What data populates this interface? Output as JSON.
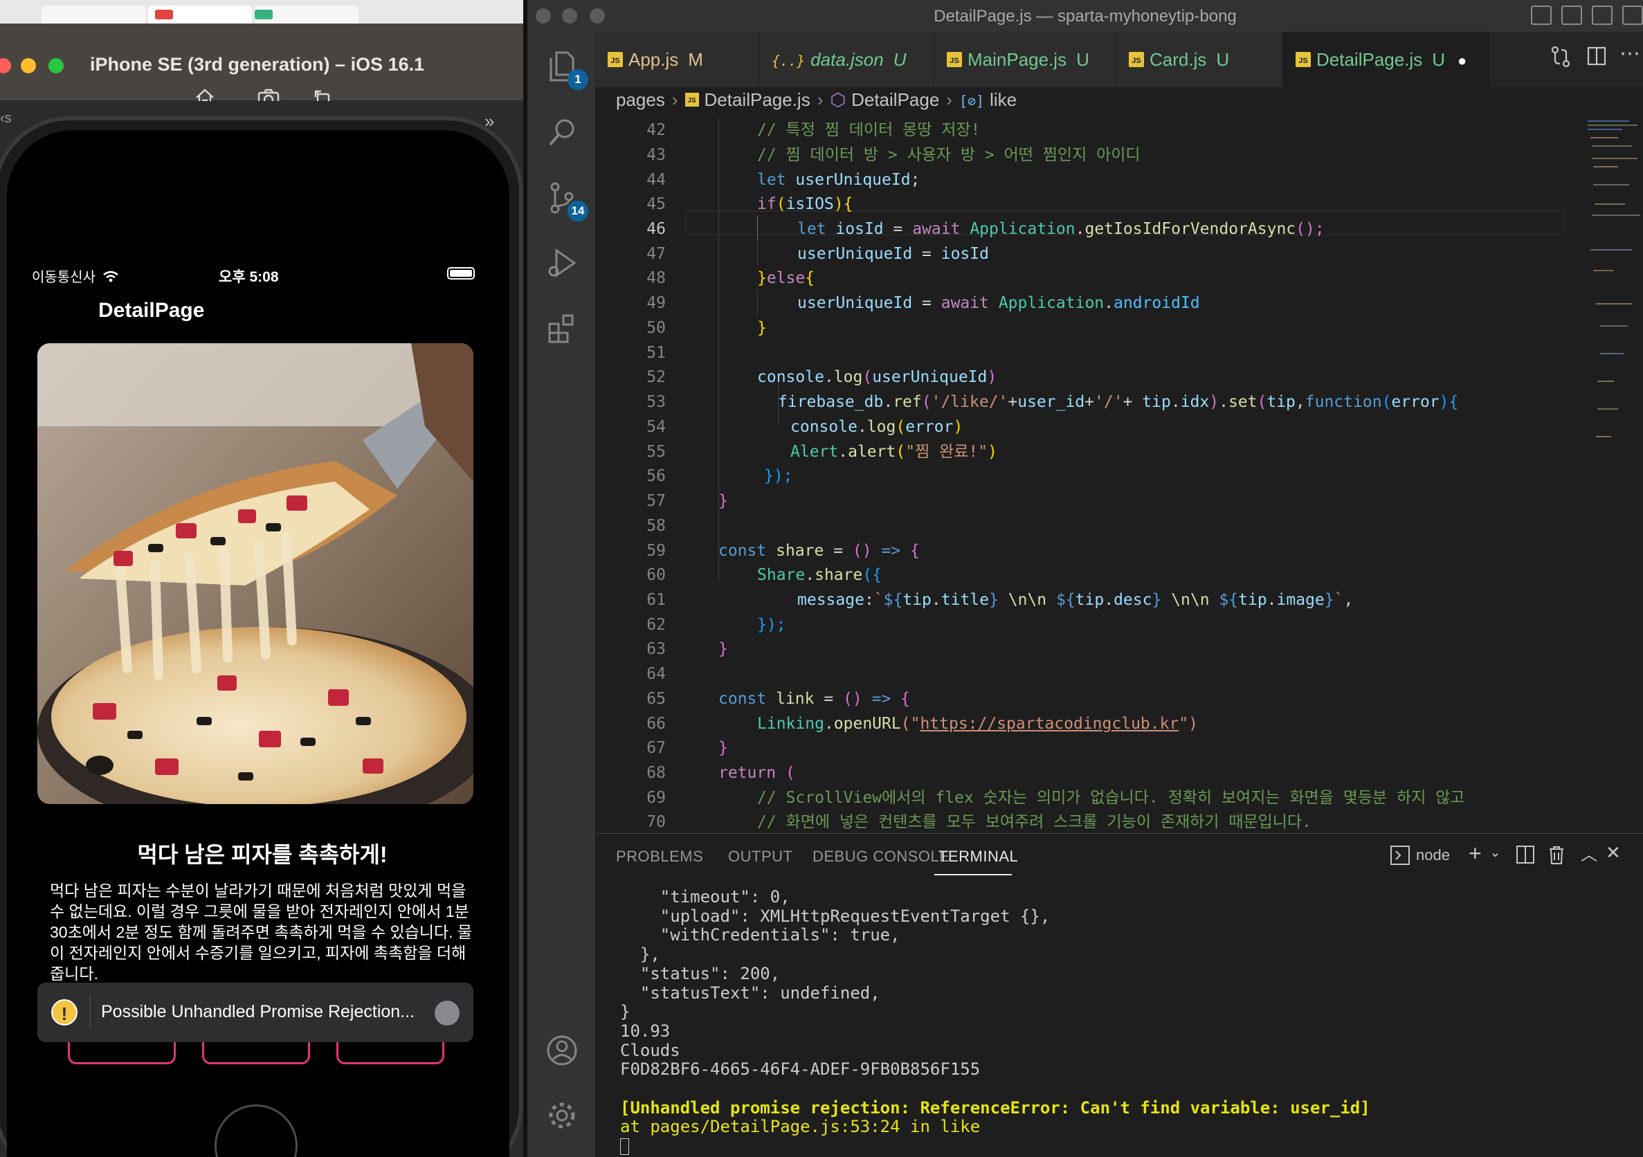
{
  "simulator": {
    "title": "iPhone SE (3rd generation) – iOS 16.1",
    "sidebar_glyph": "‹s",
    "overflow_glyph": "»",
    "tools": [
      "home-icon",
      "screenshot-icon",
      "rotate-icon"
    ],
    "status": {
      "carrier": "이동통신사",
      "time": "오후 5:08"
    },
    "nav_title": "DetailPage",
    "tip": {
      "title": "먹다 남은 피자를 촉촉하게!",
      "desc": "먹다 남은 피자는 수분이 날라가기 때문에 처음처럼 맛있게 먹을 수 없는데요. 이럴 경우 그릇에 물을 받아 전자레인지 안에서 1분 30초에서 2분 정도 함께 돌려주면 촉촉하게 먹을 수 있습니다. 물이 전자레인지 안에서 수증기를 일으키고, 피자에 촉촉함을 더해줍니다."
    },
    "toast": {
      "icon": "!",
      "text": "Possible Unhandled Promise Rejection..."
    },
    "colors": {
      "button_border": "#e3337f",
      "toast_icon": "#f4c542"
    }
  },
  "vscode": {
    "window_title": "DetailPage.js — sparta-myhoneytip-bong",
    "activity_badges": {
      "explorer": "1",
      "source_control": "14"
    },
    "tabs": [
      {
        "label": "App.js",
        "status": "M",
        "kind": "js"
      },
      {
        "label": "data.json",
        "status": "U",
        "kind": "json",
        "json_glyph": "{..}"
      },
      {
        "label": "MainPage.js",
        "status": "U",
        "kind": "js"
      },
      {
        "label": "Card.js",
        "status": "U",
        "kind": "js"
      },
      {
        "label": "DetailPage.js",
        "status": "U",
        "kind": "js",
        "active": true,
        "dirty_glyph": "●"
      }
    ],
    "breadcrumb": [
      "pages",
      "DetailPage.js",
      "DetailPage",
      "like"
    ],
    "line_numbers": [
      "42",
      "43",
      "44",
      "45",
      "46",
      "47",
      "48",
      "49",
      "50",
      "51",
      "52",
      "53",
      "54",
      "55",
      "56",
      "57",
      "58",
      "59",
      "60",
      "61",
      "62",
      "63",
      "64",
      "65",
      "66",
      "67",
      "68",
      "69",
      "70"
    ],
    "code": {
      "l42": "// 특정 찜 데이터 몽땅 저장!",
      "l43": "// 찜 데이터 방 > 사용자 방 > 어떤 찜인지 아이디",
      "l44_kw": "let",
      "l44_var": "userUniqueId",
      "l44_semi": ";",
      "l45_if": "if",
      "l45_open": "(",
      "l45_var": "isIOS",
      "l45_close": "){",
      "l46_kw": "let",
      "l46_var": "iosId",
      "l46_eq": " = ",
      "l46_await": "await",
      "l46_cls": "Application",
      "l46_dot": ".",
      "l46_fn": "getIosIdForVendorAsync",
      "l46_end": "();",
      "l47_var": "userUniqueId",
      "l47_eq": " = ",
      "l47_val": "iosId",
      "l48_close": "}",
      "l48_else": "else",
      "l48_open": "{",
      "l49_var": "userUniqueId",
      "l49_eq": " = ",
      "l49_await": "await",
      "l49_cls": "Application",
      "l49_dot": ".",
      "l49_prop": "androidId",
      "l50": "}",
      "l52_obj": "console",
      "l52_dot": ".",
      "l52_fn": "log",
      "l52_open": "(",
      "l52_arg": "userUniqueId",
      "l52_close": ")",
      "l53_obj": "firebase_db",
      "l53_dot1": ".",
      "l53_fn1": "ref",
      "l53_open": "(",
      "l53_s1": "'/like/'",
      "l53_plus1": "+",
      "l53_v1": "user_id",
      "l53_plus2": "+",
      "l53_s2": "'/'",
      "l53_plus3": "+ ",
      "l53_v2": "tip",
      "l53_dot2": ".",
      "l53_v3": "idx",
      "l53_close": ")",
      "l53_dot3": ".",
      "l53_fn2": "set",
      "l53_open2": "(",
      "l53_v4": "tip",
      "l53_comma": ",",
      "l53_kw": "function",
      "l53_open3": "(",
      "l53_v5": "error",
      "l53_close3": "){",
      "l54_obj": "console",
      "l54_dot": ".",
      "l54_fn": "log",
      "l54_open": "(",
      "l54_arg": "error",
      "l54_close": ")",
      "l55_obj": "Alert",
      "l55_dot": ".",
      "l55_fn": "alert",
      "l55_open": "(",
      "l55_str": "\"찜 완료!\"",
      "l55_close": ")",
      "l56": "});",
      "l57": "}",
      "l59_kw": "const",
      "l59_name": "share",
      "l59_eq": " = ",
      "l59_paren": "()",
      "l59_arrow": " => ",
      "l59_brace": "{",
      "l60_cls": "Share",
      "l60_dot": ".",
      "l60_fn": "share",
      "l60_open": "({",
      "l61_key": "message",
      "l61_colon": ":",
      "l61_tick": "`",
      "l61_i1o": "${",
      "l61_v1": "tip",
      "l61_d1": ".",
      "l61_p1": "title",
      "l61_i1c": "}",
      "l61_nl1": " \\n\\n ",
      "l61_i2o": "${",
      "l61_v2": "tip",
      "l61_d2": ".",
      "l61_p2": "desc",
      "l61_i2c": "}",
      "l61_nl2": " \\n\\n ",
      "l61_i3o": "${",
      "l61_v3": "tip",
      "l61_d3": ".",
      "l61_p3": "image",
      "l61_i3c": "}",
      "l61_end": "`",
      "l61_comma": ",",
      "l62": "});",
      "l63": "}",
      "l65_kw": "const",
      "l65_name": "link",
      "l65_eq": " = ",
      "l65_paren": "()",
      "l65_arrow": " => ",
      "l65_brace": "{",
      "l66_cls": "Linking",
      "l66_dot": ".",
      "l66_fn": "openURL",
      "l66_open": "(\"",
      "l66_url": "https://spartacodingclub.kr",
      "l66_close": "\")",
      "l67": "}",
      "l68_kw": "return",
      "l68_paren": " (",
      "l69": "// ScrollView에서의 flex 숫자는 의미가 없습니다. 정확히 보여지는 화면을 몇등분 하지 않고",
      "l70": "// 화면에 넣은 컨텐츠를 모두 보여주려 스크롤 기능이 존재하기 때문입니다."
    },
    "panel": {
      "tabs": [
        "PROBLEMS",
        "OUTPUT",
        "DEBUG CONSOLE",
        "TERMINAL"
      ],
      "active_tab": "TERMINAL",
      "shell": "node",
      "terminal_lines": [
        "    \"timeout\": 0,",
        "    \"upload\": XMLHttpRequestEventTarget {},",
        "    \"withCredentials\": true,",
        "  },",
        "  \"status\": 200,",
        "  \"statusText\": undefined,",
        "}",
        "10.93",
        "Clouds",
        "F0D82BF6-4665-46F4-ADEF-9FB0B856F155",
        ""
      ],
      "error_line": "[Unhandled promise rejection: ReferenceError: Can't find variable: user_id]",
      "at_line": "at pages/DetailPage.js:53:24 in like"
    },
    "colors": {
      "accent_badge": "#0e639c",
      "error_yellow": "#e5e510",
      "untracked_green": "#73c991",
      "modified": "#e2c08d"
    }
  }
}
